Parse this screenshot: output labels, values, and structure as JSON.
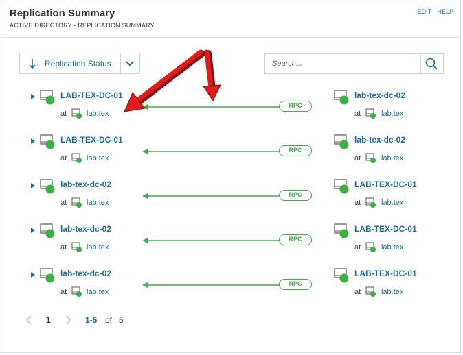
{
  "header": {
    "title": "Replication Summary",
    "subtitle": "ACTIVE DIRECTORY - REPLICATION SUMMARY",
    "edit_label": "EDIT",
    "help_label": "HELP"
  },
  "toolbar": {
    "sort_label": "Replication Status",
    "search_placeholder": "Search..."
  },
  "rows": [
    {
      "source": "LAB-TEX-DC-01",
      "source_domain": "lab.tex",
      "protocol": "RPC",
      "target": "lab-tex-dc-02",
      "target_domain": "lab.tex"
    },
    {
      "source": "LAB-TEX-DC-01",
      "source_domain": "lab.tex",
      "protocol": "RPC",
      "target": "lab-tex-dc-02",
      "target_domain": "lab.tex"
    },
    {
      "source": "lab-tex-dc-02",
      "source_domain": "lab.tex",
      "protocol": "RPC",
      "target": "LAB-TEX-DC-01",
      "target_domain": "lab.tex"
    },
    {
      "source": "lab-tex-dc-02",
      "source_domain": "lab.tex",
      "protocol": "RPC",
      "target": "LAB-TEX-DC-01",
      "target_domain": "lab.tex"
    },
    {
      "source": "lab-tex-dc-02",
      "source_domain": "lab.tex",
      "protocol": "RPC",
      "target": "LAB-TEX-DC-01",
      "target_domain": "lab.tex"
    }
  ],
  "common": {
    "at_label": "at"
  },
  "pager": {
    "current_page": "1",
    "range": "1-5",
    "of_label": "of",
    "total": "5"
  },
  "colors": {
    "link": "#1a6f9e",
    "status_up": "#3cb043",
    "replication_line": "#3cb043",
    "annotation_arrow": "#e01b1b"
  },
  "icons": {
    "sort": "arrow-down-icon",
    "dropdown": "chevron-down-icon",
    "search": "search-icon",
    "expand": "caret-right-icon",
    "server": "server-status-icon"
  }
}
